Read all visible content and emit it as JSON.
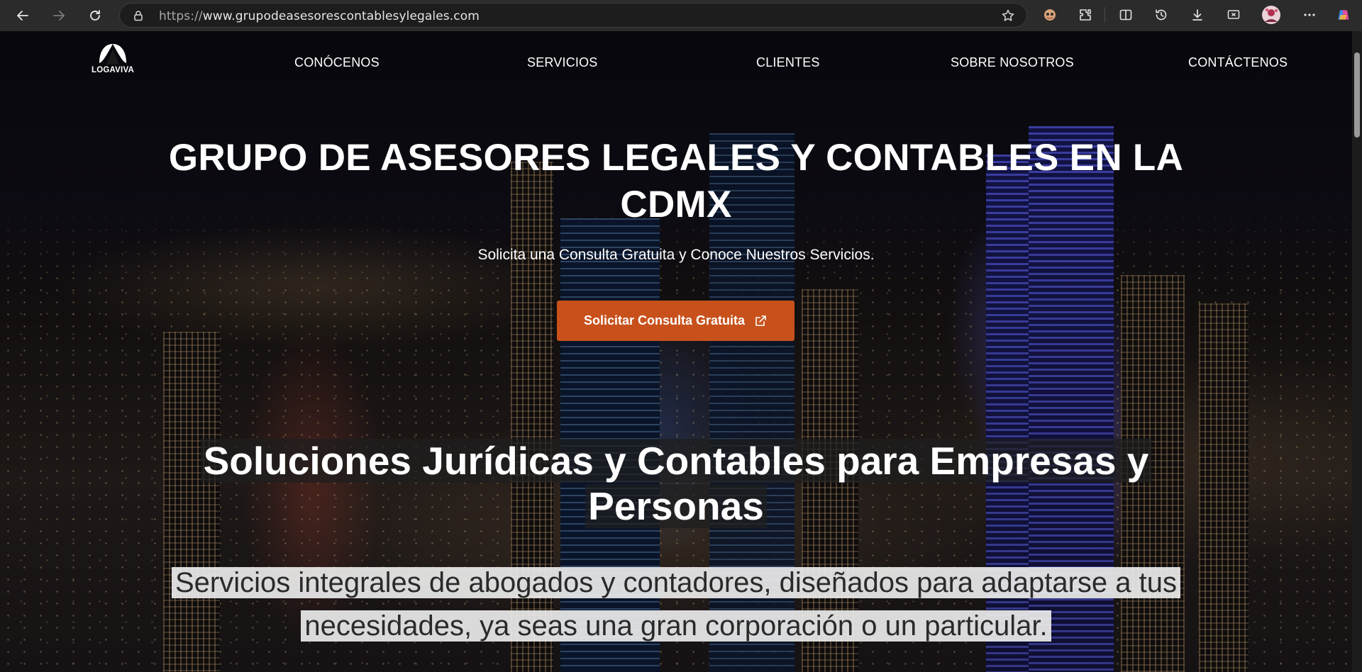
{
  "browser": {
    "url_scheme": "https://",
    "url_host": "www.grupodeasesorescontablesylegales.com",
    "toolbar_icons": [
      "back-icon",
      "forward-icon",
      "refresh-icon",
      "lock-icon",
      "star-icon",
      "profile-extension-icon",
      "extensions-icon",
      "split-screen-icon",
      "history-icon",
      "downloads-icon",
      "screenshot-icon",
      "avatar",
      "more-icon",
      "copilot-icon"
    ]
  },
  "site": {
    "logo_text": "LOGAVIVA",
    "nav": [
      "CONÓCENOS",
      "SERVICIOS",
      "CLIENTES",
      "SOBRE NOSOTROS",
      "CONTÁCTENOS"
    ],
    "hero": {
      "title": "GRUPO DE ASESORES LEGALES Y CONTABLES EN LA CDMX",
      "subtitle": "Solicita una Consulta Gratuita y Conoce Nuestros Servicios.",
      "cta_label": "Solicitar Consulta Gratuita",
      "cta_color": "#c8511b"
    },
    "section": {
      "title": "Soluciones Jurídicas y Contables para Empresas y Personas",
      "description": "Servicios integrales de abogados y contadores, diseñados para adaptarse a tus necesidades, ya seas una gran corporación o un particular."
    }
  }
}
